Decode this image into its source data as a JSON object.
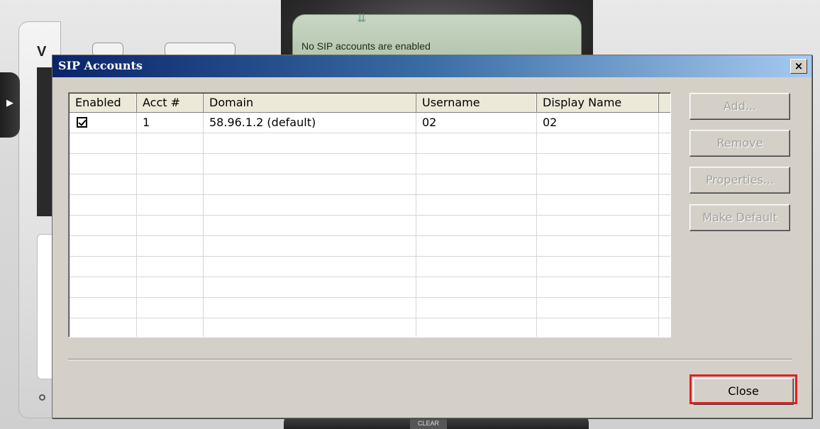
{
  "background": {
    "phone_status": "No SIP accounts are enabled",
    "left_panel_title": "V",
    "clear_label": "CLEAR"
  },
  "dialog": {
    "title": "SIP Accounts",
    "close_x": "×"
  },
  "table": {
    "columns": [
      "Enabled",
      "Acct #",
      "Domain",
      "Username",
      "Display Name"
    ],
    "rows": [
      {
        "enabled": true,
        "acct": "1",
        "domain": "58.96.1.2 (default)",
        "username": "02",
        "display_name": "02"
      }
    ],
    "empty_rows": 10
  },
  "buttons": {
    "add": "Add...",
    "remove": "Remove",
    "properties": "Properties...",
    "make_default": "Make Default",
    "close": "Close"
  },
  "colors": {
    "title_gradient_start": "#0a246a",
    "title_gradient_end": "#a6caf0",
    "dialog_face": "#d4d0c8",
    "highlight": "#e02020"
  }
}
